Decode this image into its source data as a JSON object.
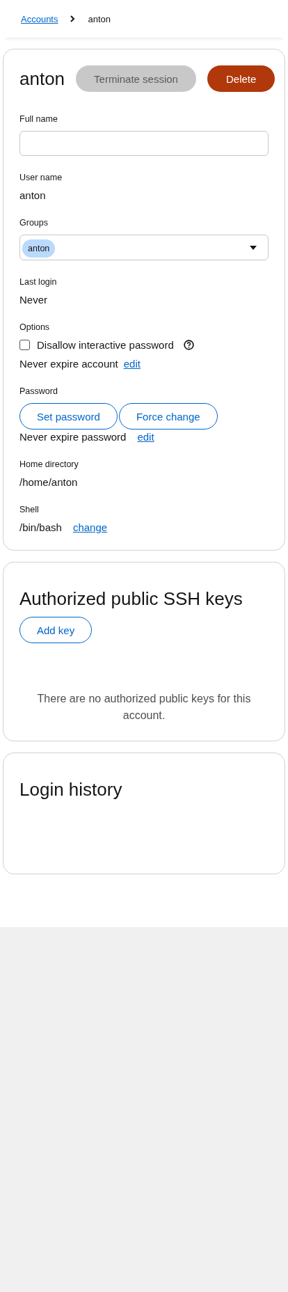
{
  "breadcrumb": [
    {
      "label": "Accounts",
      "kind": "link"
    },
    {
      "label": "anton",
      "kind": "current"
    }
  ],
  "account": {
    "title": "anton",
    "actions": [
      {
        "label": "Terminate session",
        "kind": "secondary",
        "disabled": true
      },
      {
        "label": "Delete",
        "kind": "danger",
        "disabled": false
      }
    ],
    "fields": [
      {
        "kind": "input",
        "label": "Full name"
      },
      {
        "kind": "text",
        "label": "User name",
        "value": "anton"
      },
      {
        "kind": "chips",
        "label": "Groups",
        "chips": [
          "anton"
        ]
      },
      {
        "kind": "text",
        "label": "Last login",
        "value": "Never"
      },
      {
        "kind": "options",
        "label": "Options",
        "checkbox": {
          "label": "Disallow interactive password",
          "checked": false
        },
        "line": {
          "text": "Never expire account",
          "link": "edit"
        }
      },
      {
        "kind": "password",
        "label": "Password",
        "buttons": [
          "Set password",
          "Force change"
        ],
        "line": {
          "text": "Never expire password",
          "link": "edit"
        }
      },
      {
        "kind": "text",
        "label": "Home directory",
        "value": "/home/anton"
      },
      {
        "kind": "textlink",
        "label": "Shell",
        "line": {
          "text": "/bin/bash",
          "link": "change"
        }
      }
    ]
  },
  "ssh_keys": {
    "title": "Authorized public SSH keys",
    "button": "Add key",
    "empty_text": "There are no authorized public keys for this account."
  },
  "login_history": {
    "title": "Login history"
  }
}
